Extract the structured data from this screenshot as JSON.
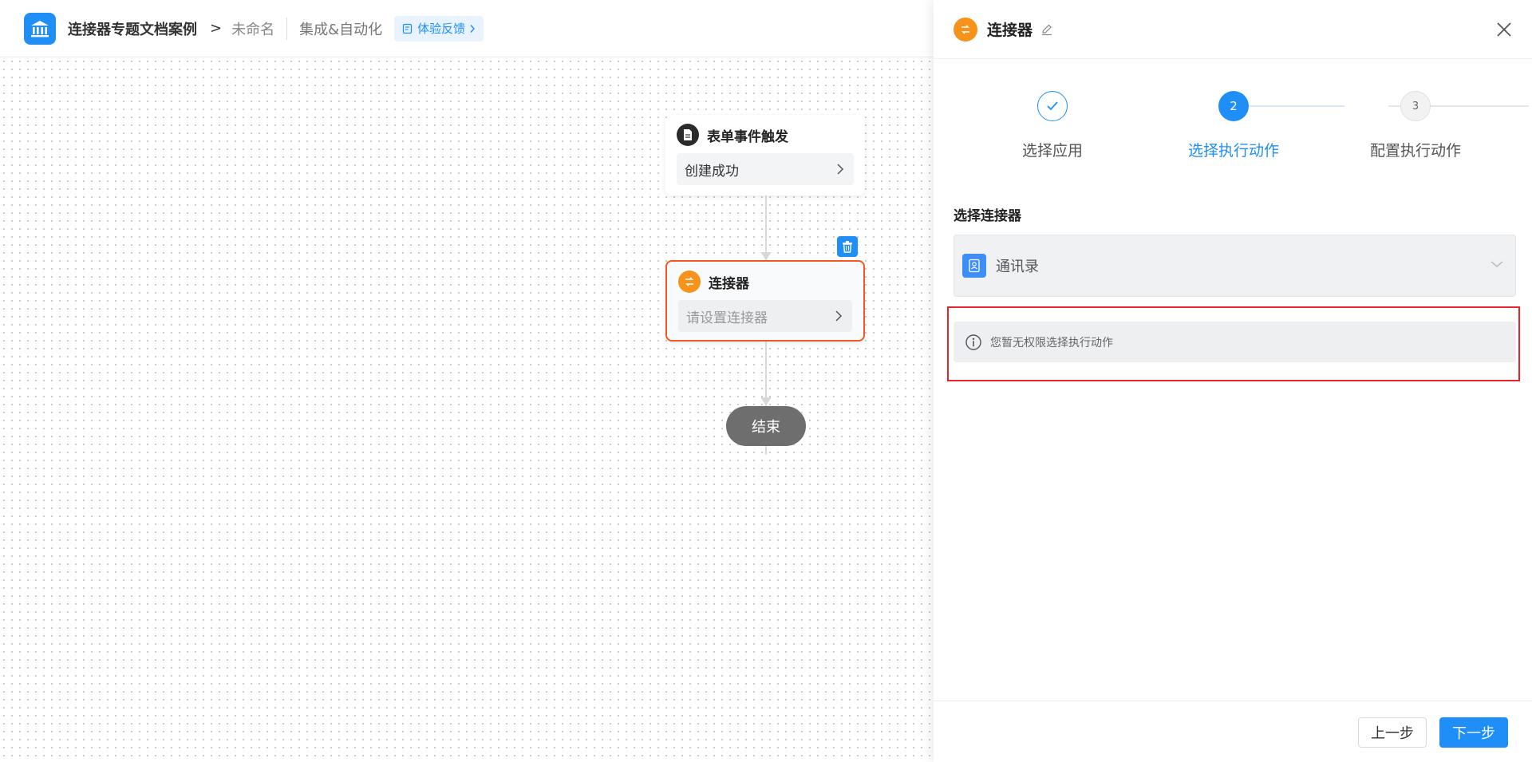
{
  "header": {
    "app_name": "连接器专题文档案例",
    "breadcrumb_arrow": ">",
    "crumb_current": "未命名",
    "nav_label": "集成&自动化",
    "feedback_label": "体验反馈"
  },
  "canvas": {
    "trigger_node": {
      "title": "表单事件触发",
      "body": "创建成功"
    },
    "connector_node": {
      "title": "连接器",
      "body": "请设置连接器"
    },
    "end_label": "结束"
  },
  "panel": {
    "title": "连接器",
    "steps": [
      {
        "number": "1",
        "label": "选择应用",
        "status": "done"
      },
      {
        "number": "2",
        "label": "选择执行动作",
        "status": "active"
      },
      {
        "number": "3",
        "label": "配置执行动作",
        "status": "pending"
      }
    ],
    "section_title": "选择连接器",
    "selected_connector": "通讯录",
    "notice": "您暂无权限选择执行动作",
    "prev_label": "上一步",
    "next_label": "下一步"
  },
  "colors": {
    "accent": "#1f8ff7",
    "connector_orange": "#f7931a",
    "selected_border": "#f15a24",
    "highlight_red": "#e8232b"
  }
}
